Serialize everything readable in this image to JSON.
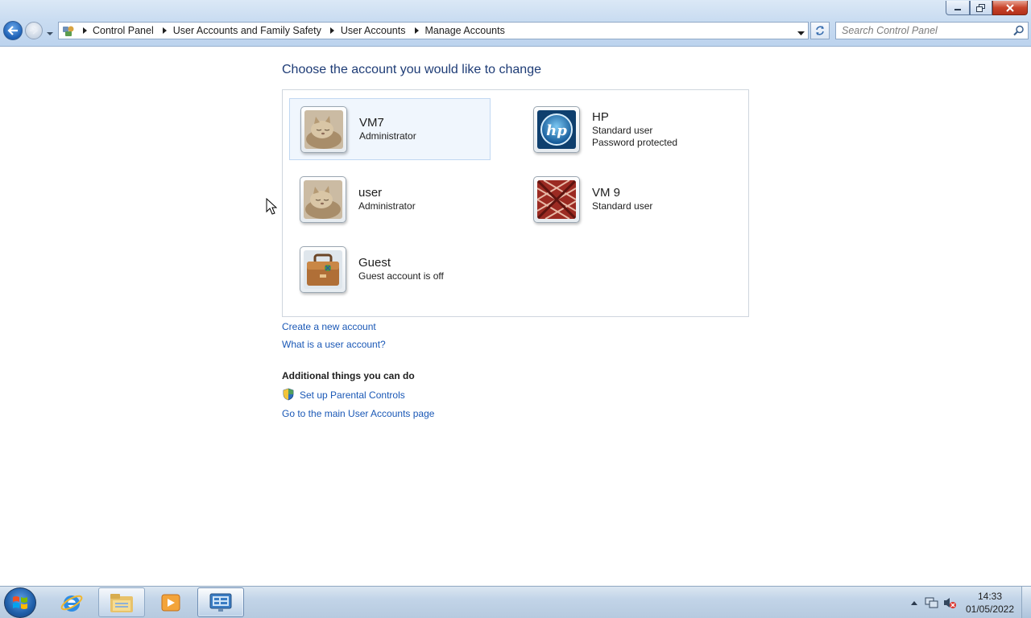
{
  "window": {
    "minimize_icon": "minimize-icon",
    "restore_icon": "restore-icon",
    "close_icon": "close-icon"
  },
  "navigation": {
    "back_icon": "back-arrow-icon",
    "forward_icon": "forward-arrow-icon",
    "breadcrumb": [
      "Control Panel",
      "User Accounts and Family Safety",
      "User Accounts",
      "Manage Accounts"
    ],
    "search_placeholder": "Search Control Panel"
  },
  "main": {
    "title": "Choose the account you would like to change",
    "accounts": [
      {
        "name": "VM7",
        "lines": [
          "Administrator"
        ],
        "avatar": "kitten",
        "selected": true
      },
      {
        "name": "HP",
        "lines": [
          "Standard user",
          "Password protected"
        ],
        "avatar": "hp-logo",
        "selected": false
      },
      {
        "name": "user",
        "lines": [
          "Administrator"
        ],
        "avatar": "kitten",
        "selected": false
      },
      {
        "name": "VM 9",
        "lines": [
          "Standard user"
        ],
        "avatar": "red-pattern",
        "selected": false
      },
      {
        "name": "Guest",
        "lines": [
          "Guest account is off"
        ],
        "avatar": "briefcase",
        "selected": false
      }
    ],
    "links": {
      "create_account": "Create a new account",
      "what_is_account": "What is a user account?"
    },
    "additional": {
      "heading": "Additional things you can do",
      "parental_controls": "Set up Parental Controls",
      "main_page": "Go to the main User Accounts page"
    }
  },
  "taskbar": {
    "clock_time": "14:33",
    "clock_date": "01/05/2022"
  },
  "colors": {
    "link": "#1a58b6",
    "title": "#1e3c76"
  }
}
